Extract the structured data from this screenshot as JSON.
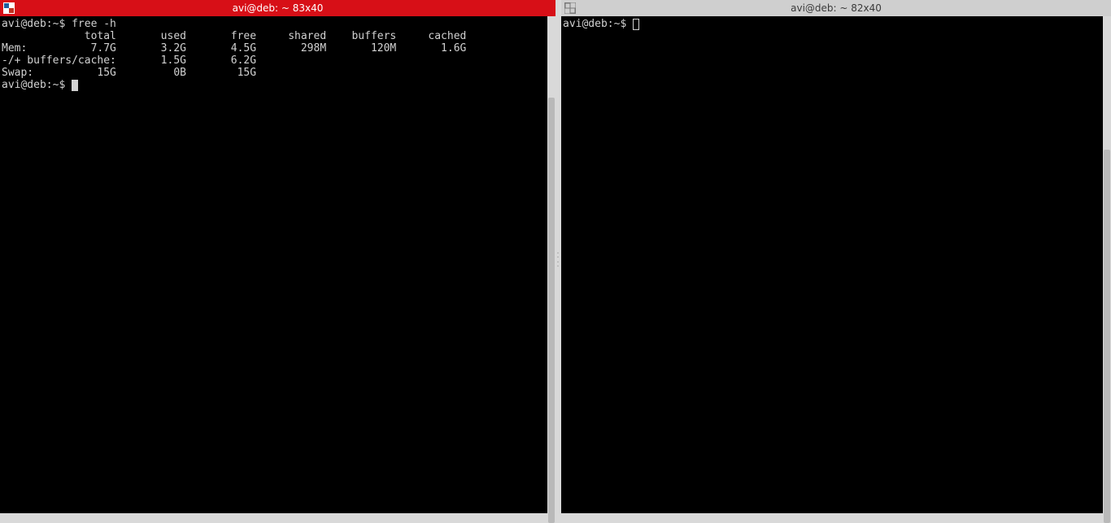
{
  "left": {
    "title": "avi@deb: ~ 83x40",
    "prompt": "avi@deb:~$ ",
    "command": "free -h",
    "output_lines": [
      "             total       used       free     shared    buffers     cached",
      "Mem:          7.7G       3.2G       4.5G       298M       120M       1.6G",
      "-/+ buffers/cache:       1.5G       6.2G",
      "Swap:          15G         0B        15G"
    ],
    "prompt2": "avi@deb:~$ "
  },
  "right": {
    "title": "avi@deb: ~ 82x40",
    "prompt": "avi@deb:~$ "
  },
  "colors": {
    "active_titlebar": "#d70f17",
    "inactive_titlebar": "#cfcfcf",
    "terminal_bg": "#000000",
    "terminal_fg": "#d1d1d1"
  },
  "chart_data": {
    "type": "table",
    "title": "free -h output",
    "columns": [
      "",
      "total",
      "used",
      "free",
      "shared",
      "buffers",
      "cached"
    ],
    "rows": [
      [
        "Mem:",
        "7.7G",
        "3.2G",
        "4.5G",
        "298M",
        "120M",
        "1.6G"
      ],
      [
        "-/+ buffers/cache:",
        "",
        "1.5G",
        "6.2G",
        "",
        "",
        ""
      ],
      [
        "Swap:",
        "15G",
        "0B",
        "15G",
        "",
        "",
        ""
      ]
    ]
  }
}
